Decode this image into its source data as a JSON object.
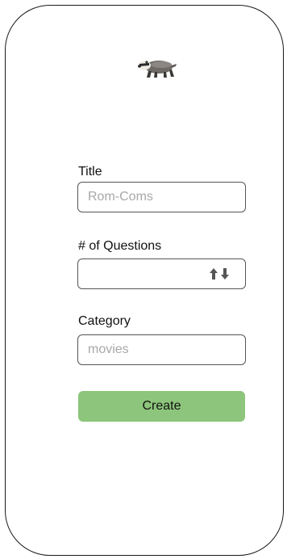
{
  "app": {
    "logo_icon": "badger-icon"
  },
  "form": {
    "title": {
      "label": "Title",
      "placeholder": "Rom-Coms",
      "value": ""
    },
    "num_questions": {
      "label": "# of Questions",
      "value": "",
      "control_icon": "up-down-arrows-icon"
    },
    "category": {
      "label": "Category",
      "placeholder": "movies",
      "value": ""
    },
    "submit": {
      "label": "Create",
      "color": "#8cc57b"
    }
  }
}
